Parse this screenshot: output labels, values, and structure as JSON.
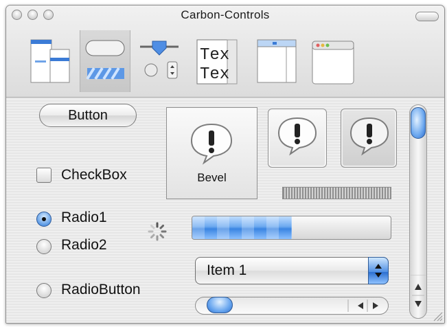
{
  "window": {
    "title": "Carbon-Controls"
  },
  "toolbar": {
    "items": [
      {
        "name": "layout-hierarchy-icon"
      },
      {
        "name": "buttons-icon",
        "selected": true
      },
      {
        "name": "sliders-radios-icon"
      },
      {
        "name": "text-icon",
        "text_line_1": "Tex",
        "text_line_2": "Tex"
      },
      {
        "name": "table-icon"
      },
      {
        "name": "window-icon"
      }
    ]
  },
  "controls": {
    "push_button": "Button",
    "checkbox": {
      "label": "CheckBox",
      "checked": false
    },
    "radios": [
      {
        "label": "Radio1",
        "selected": true
      },
      {
        "label": "Radio2",
        "selected": false
      }
    ],
    "radio_button": {
      "label": "RadioButton",
      "selected": false
    },
    "bevel_label": "Bevel",
    "progress": {
      "value": 0.5
    },
    "popup": {
      "selected": "Item 1"
    },
    "slider": {
      "value": 0.0
    },
    "scrollbar": {
      "value": 0.0
    }
  },
  "colors": {
    "accent": "#3a85e2",
    "window_bg": "#dfdfdf"
  }
}
